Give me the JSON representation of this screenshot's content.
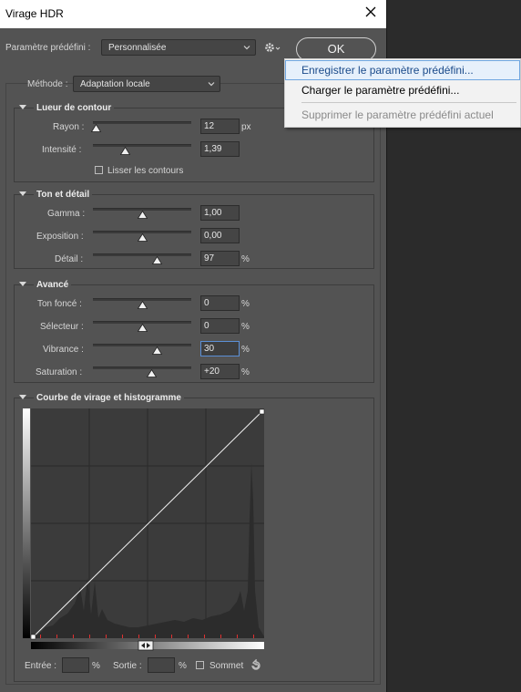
{
  "window": {
    "title": "Virage HDR",
    "close_icon": "close-icon"
  },
  "preset": {
    "label": "Paramètre prédéfini :",
    "value": "Personnalisée"
  },
  "ok_label": "OK",
  "method": {
    "label": "Méthode :",
    "value": "Adaptation locale"
  },
  "menu": {
    "items": [
      {
        "label": "Enregistrer le paramètre prédéfini...",
        "state": "highlighted"
      },
      {
        "label": "Charger le paramètre prédéfini...",
        "state": "enabled"
      },
      {
        "label": "Supprimer le paramètre prédéfini actuel",
        "state": "disabled"
      }
    ]
  },
  "edge_glow": {
    "title": "Lueur de contour",
    "radius": {
      "label": "Rayon :",
      "value": "12",
      "unit": "px",
      "level": 0.03
    },
    "strength": {
      "label": "Intensité :",
      "value": "1,39",
      "unit": "",
      "level": 0.33
    },
    "smooth_edges": {
      "label": "Lisser les contours",
      "checked": false
    }
  },
  "tone_detail": {
    "title": "Ton et détail",
    "gamma": {
      "label": "Gamma :",
      "value": "1,00",
      "unit": "",
      "level": 0.5
    },
    "exposure": {
      "label": "Exposition :",
      "value": "0,00",
      "unit": "",
      "level": 0.5
    },
    "detail": {
      "label": "Détail :",
      "value": "97",
      "unit": "%",
      "level": 0.65
    }
  },
  "advanced": {
    "title": "Avancé",
    "shadow": {
      "label": "Ton foncé :",
      "value": "0",
      "unit": "%",
      "level": 0.5
    },
    "highlight": {
      "label": "Sélecteur :",
      "value": "0",
      "unit": "%",
      "level": 0.5
    },
    "vibrance": {
      "label": "Vibrance :",
      "value": "30",
      "unit": "%",
      "level": 0.65
    },
    "saturation": {
      "label": "Saturation :",
      "value": "+20",
      "unit": "%",
      "level": 0.6
    }
  },
  "curve": {
    "title": "Courbe de virage et histogramme",
    "input_label": "Entrée :",
    "input_unit": "%",
    "output_label": "Sortie :",
    "output_unit": "%",
    "corner_label": "Sommet",
    "input_value": "",
    "output_value": ""
  },
  "colors": {
    "dialog_bg": "#535353",
    "accent": "#5b8fd6",
    "menu_highlight": "#e6f0fb"
  }
}
